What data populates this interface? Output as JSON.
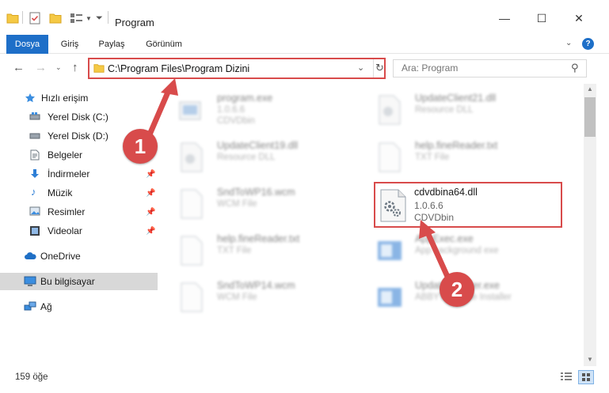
{
  "window": {
    "title": "Program",
    "minimize_glyph": "—",
    "maximize_glyph": "☐",
    "close_glyph": "✕"
  },
  "ribbon": {
    "tabs": [
      "Dosya",
      "Giriş",
      "Paylaş",
      "Görünüm"
    ],
    "active_tab": "Dosya",
    "help_glyph": "?",
    "accent": "#1e6fc8"
  },
  "address_bar": {
    "path": "C:\\Program Files\\Program Dizini",
    "highlight_color": "#d84b4b"
  },
  "search": {
    "placeholder": "Ara: Program"
  },
  "sidebar": {
    "items": [
      {
        "label": "Hızlı erişim",
        "icon": "star-icon"
      },
      {
        "label": "Yerel Disk (C:)",
        "icon": "drive-icon"
      },
      {
        "label": "Yerel Disk (D:)",
        "icon": "drive-icon"
      },
      {
        "label": "Belgeler",
        "icon": "document-icon"
      },
      {
        "label": "İndirmeler",
        "icon": "download-icon"
      },
      {
        "label": "Müzik",
        "icon": "music-icon"
      },
      {
        "label": "Resimler",
        "icon": "pictures-icon"
      },
      {
        "label": "Videolar",
        "icon": "video-icon"
      },
      {
        "label": "OneDrive",
        "icon": "cloud-icon"
      },
      {
        "label": "Bu bilgisayar",
        "icon": "computer-icon"
      },
      {
        "label": "Ağ",
        "icon": "network-icon"
      }
    ],
    "selected": "Bu bilgisayar"
  },
  "files": [
    {
      "name": "program.exe",
      "line2": "1.0.6.6",
      "line3": "CDVDbin",
      "icon": "app-icon",
      "blurred": true
    },
    {
      "name": "UpdateClient21.dll",
      "line2": "Resource DLL",
      "line3": "",
      "icon": "dll-icon",
      "blurred": true
    },
    {
      "name": "UpdateClient19.dll",
      "line2": "Resource DLL",
      "line3": "",
      "icon": "dll-icon",
      "blurred": true
    },
    {
      "name": "help.fineReader.txt",
      "line2": "TXT File",
      "line3": "",
      "icon": "text-file-icon",
      "blurred": true
    },
    {
      "name": "SndToWP16.wcm",
      "line2": "WCM File",
      "line3": "",
      "icon": "blank-file-icon",
      "blurred": true
    },
    {
      "name": "cdvdbina64.dll",
      "line2": "1.0.6.6",
      "line3": "CDVDbin",
      "icon": "dll-gear-icon",
      "blurred": false
    },
    {
      "name": "help.fineReader.txt",
      "line2": "TXT File",
      "line3": "",
      "icon": "text-file-icon",
      "blurred": true
    },
    {
      "name": "AppExec.exe",
      "line2": "App background exe",
      "line3": "",
      "icon": "installer-icon",
      "blurred": true
    },
    {
      "name": "SndToWP14.wcm",
      "line2": "WCM File",
      "line3": "",
      "icon": "blank-file-icon",
      "blurred": true
    },
    {
      "name": "UpdateInstaller.exe",
      "line2": "ABBYY Update Installer",
      "line3": "",
      "icon": "installer-icon",
      "blurred": true
    }
  ],
  "status": {
    "count": "159 öğe"
  },
  "callouts": [
    "1",
    "2"
  ]
}
